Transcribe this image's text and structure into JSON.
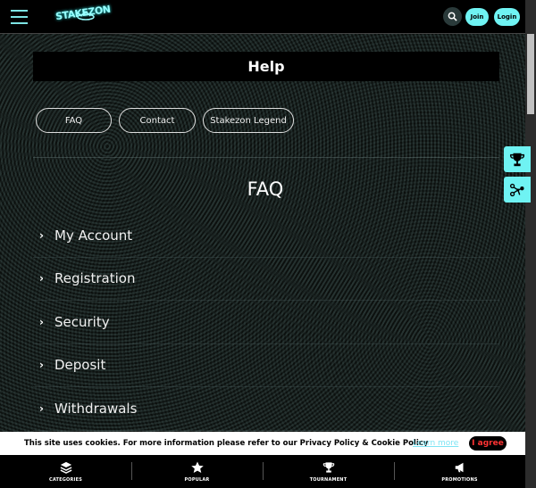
{
  "header": {
    "logo_text": "STAKEZON",
    "join_label": "Join",
    "login_label": "Login"
  },
  "help": {
    "title": "Help"
  },
  "tabs": [
    {
      "label": "FAQ"
    },
    {
      "label": "Contact"
    },
    {
      "label": "Stakezon Legend"
    }
  ],
  "faq": {
    "title": "FAQ",
    "items": [
      {
        "label": "My Account"
      },
      {
        "label": "Registration"
      },
      {
        "label": "Security"
      },
      {
        "label": "Deposit"
      },
      {
        "label": "Withdrawals"
      }
    ]
  },
  "side_buttons": [
    {
      "icon": "trophy-icon"
    },
    {
      "icon": "network-icon"
    }
  ],
  "cookie": {
    "text": "This site uses cookies. For more information please refer to our Privacy Policy & Cookie Policy",
    "learn_more": "Learn more",
    "agree": "I agree"
  },
  "bottom_nav": [
    {
      "label": "CATEGORIES",
      "icon": "layers-icon"
    },
    {
      "label": "POPULAR",
      "icon": "star-icon"
    },
    {
      "label": "TOURNAMENT",
      "icon": "trophy-icon"
    },
    {
      "label": "PROMOTIONS",
      "icon": "megaphone-icon"
    }
  ],
  "colors": {
    "accent": "#6ff3f3",
    "agree_text": "#ff3333"
  }
}
